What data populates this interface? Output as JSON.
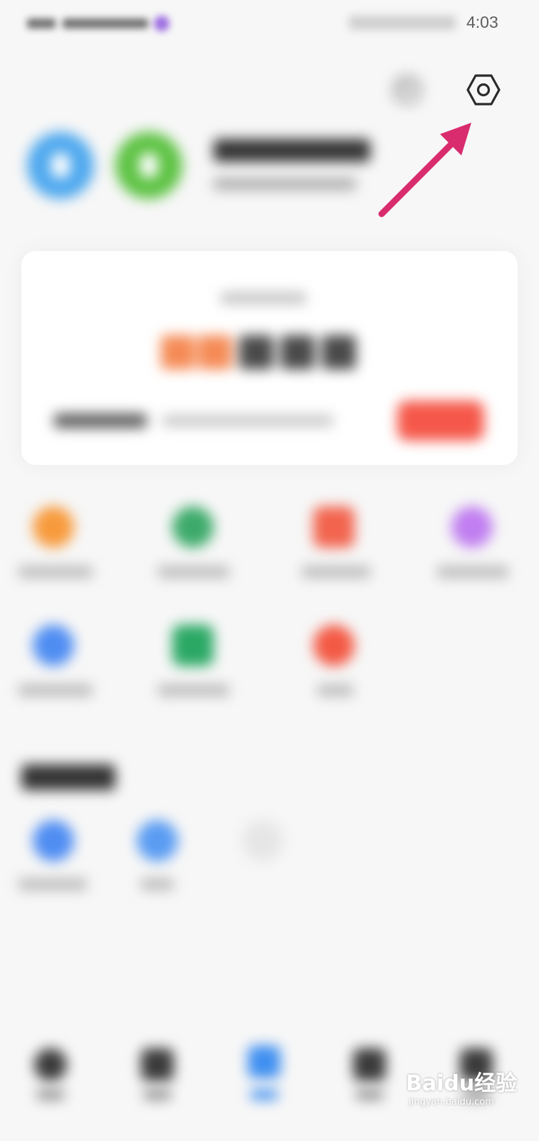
{
  "status_bar": {
    "time": "4:03"
  },
  "watermark": {
    "text": "Baidu经验",
    "url": "jingyan.baidu.com"
  },
  "colors": {
    "arrow": "#d92c6e",
    "avatar_blue": "#4ea8ee",
    "avatar_green": "#5cc242",
    "action_button": "#f5584a",
    "highlight_orange": "#f58b56",
    "tab_active": "#3f8ff0"
  },
  "icons": {
    "settings": "gear-icon",
    "messages": "message-icon"
  }
}
